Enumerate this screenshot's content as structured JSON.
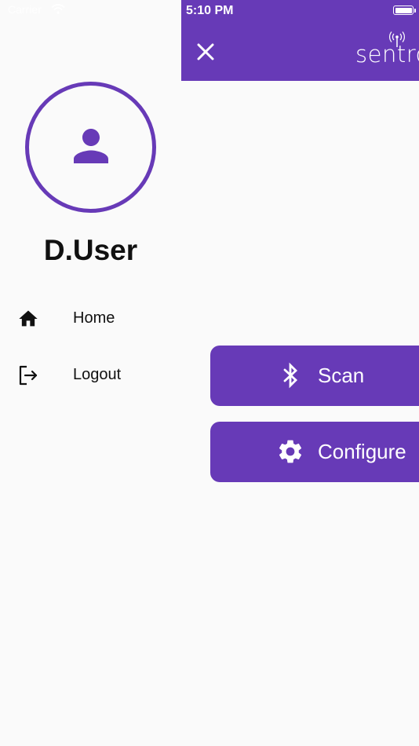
{
  "status_bar": {
    "carrier": "Carrier",
    "time": "5:10 PM"
  },
  "app_bar": {
    "logo_text": "sentro"
  },
  "drawer": {
    "username": "D.User",
    "items": [
      {
        "label": "Home",
        "icon": "home-icon"
      },
      {
        "label": "Logout",
        "icon": "logout-icon"
      }
    ]
  },
  "main": {
    "actions": [
      {
        "label": "Scan",
        "icon": "bluetooth-icon"
      },
      {
        "label": "Configure",
        "icon": "gear-icon"
      }
    ]
  },
  "colors": {
    "primary": "#673ab7",
    "background": "#fafafa",
    "text": "#111111"
  }
}
